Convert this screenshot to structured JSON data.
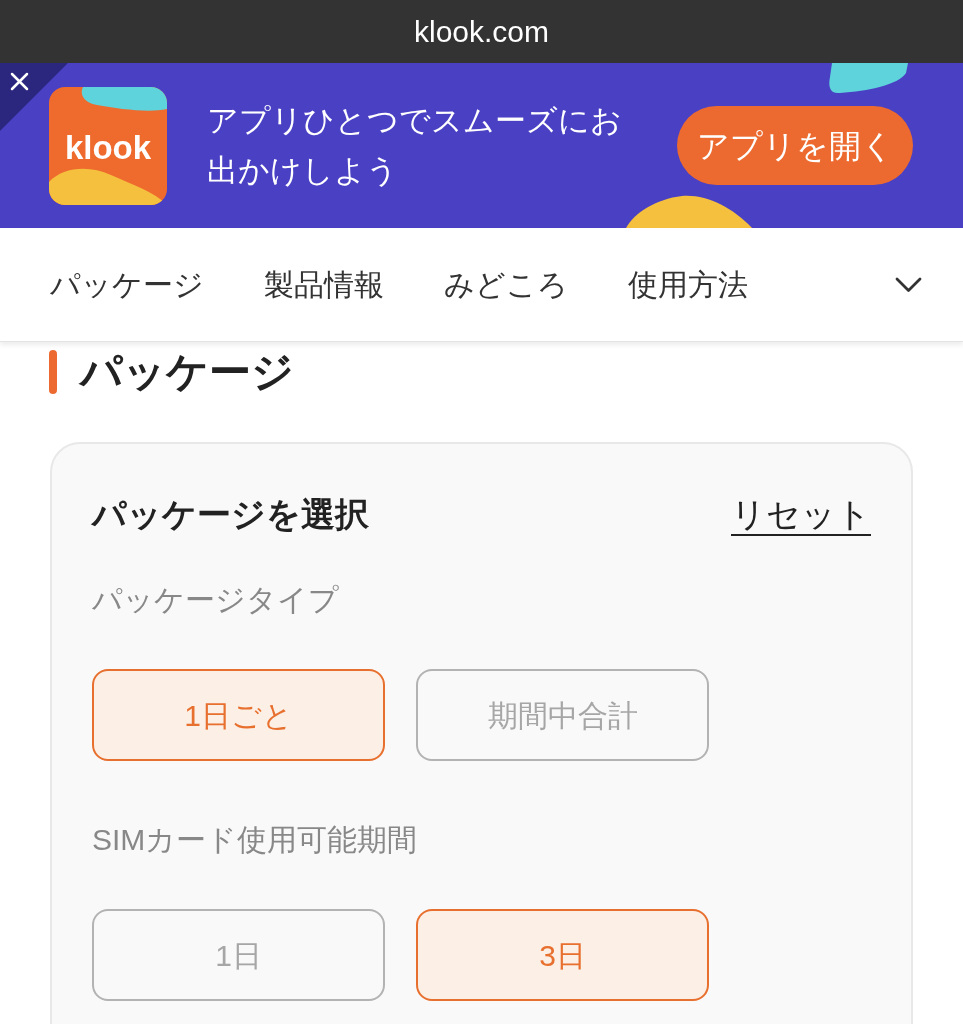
{
  "browser_bar": {
    "url": "klook.com"
  },
  "app_banner": {
    "logo_text": "klook",
    "message": "アプリひとつでスムーズにお出かけしよう",
    "button": "アプリを開く"
  },
  "nav_tabs": [
    "パッケージ",
    "製品情報",
    "みどころ",
    "使用方法"
  ],
  "section": {
    "title": "パッケージ"
  },
  "package_card": {
    "title": "パッケージを選択",
    "reset": "リセット",
    "option_groups": [
      {
        "label": "パッケージタイプ",
        "options": [
          {
            "label": "1日ごと",
            "selected": true
          },
          {
            "label": "期間中合計",
            "selected": false
          }
        ]
      },
      {
        "label": "SIMカード使用可能期間",
        "options": [
          {
            "label": "1日",
            "selected": false
          },
          {
            "label": "3日",
            "selected": true
          }
        ]
      }
    ]
  }
}
